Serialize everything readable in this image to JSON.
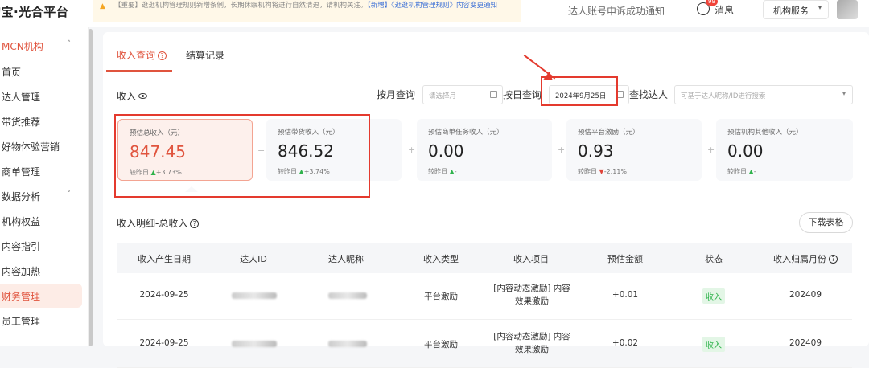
{
  "header": {
    "logo": "淘宝·光合平台",
    "notice_text": "【重要】逛逛机构管理规则新增条例，长期休眠机构将进行自然清退，请机构关注。",
    "notice_link": "【新增】《逛逛机构管理规则》内容变更通知",
    "notice_prefix": "【重要】逛逛机构管理规则新增条例，长期休眠机构将进行自然清退，请机构关注。",
    "marquee": "达人账号申诉成功通知",
    "messages_label": "消息",
    "messages_badge": "99",
    "org_service": "机构服务"
  },
  "sidebar": {
    "group": "MCN机构",
    "items": [
      "首页",
      "达人管理",
      "带货推荐",
      "好物体验营销",
      "商单管理",
      "数据分析",
      "机构权益",
      "内容指引",
      "内容加热",
      "财务管理",
      "员工管理"
    ],
    "active": "财务管理"
  },
  "tabs": {
    "income": "收入查询",
    "settlement": "结算记录"
  },
  "filters": {
    "income_label": "收入",
    "by_month_label": "按月查询",
    "month_placeholder": "请选择月",
    "by_day_label": "按日查询",
    "day_value": "2024年9月25日",
    "find_talent_label": "查找达人",
    "talent_placeholder": "可基于达人昵称/ID进行搜索"
  },
  "metrics": [
    {
      "label": "预估总收入（元）",
      "value": "847.45",
      "compare_label": "较昨日",
      "trend": "up",
      "change": "+3.73%"
    },
    {
      "label": "预估带货收入（元）",
      "value": "846.52",
      "compare_label": "较昨日",
      "trend": "up",
      "change": "+3.74%"
    },
    {
      "label": "预估商单任务收入（元）",
      "value": "0.00",
      "compare_label": "较昨日",
      "trend": "up",
      "change": "-"
    },
    {
      "label": "预估平台激励（元）",
      "value": "0.93",
      "compare_label": "较昨日",
      "trend": "down",
      "change": "-2.11%"
    },
    {
      "label": "预估机构其他收入（元）",
      "value": "0.00",
      "compare_label": "较昨日",
      "trend": "up",
      "change": "-"
    }
  ],
  "operators": [
    "=",
    "+",
    "+",
    "+"
  ],
  "detail": {
    "title": "收入明细-总收入",
    "download": "下载表格",
    "columns": [
      "收入产生日期",
      "达人ID",
      "达人昵称",
      "收入类型",
      "收入项目",
      "预估金额",
      "状态",
      "收入归属月份"
    ],
    "rows": [
      {
        "date": "2024-09-25",
        "type": "平台激励",
        "item": "[内容动态激励] 内容效果激励",
        "amount": "+0.01",
        "status": "收入",
        "month": "202409"
      },
      {
        "date": "2024-09-25",
        "type": "平台激励",
        "item": "[内容动态激励] 内容效果激励",
        "amount": "+0.02",
        "status": "收入",
        "month": "202409"
      }
    ]
  },
  "colors": {
    "accent": "#e0543e",
    "annotation_red": "#e43a2e",
    "up_green": "#2fb34c",
    "down_red": "#e0443a"
  }
}
